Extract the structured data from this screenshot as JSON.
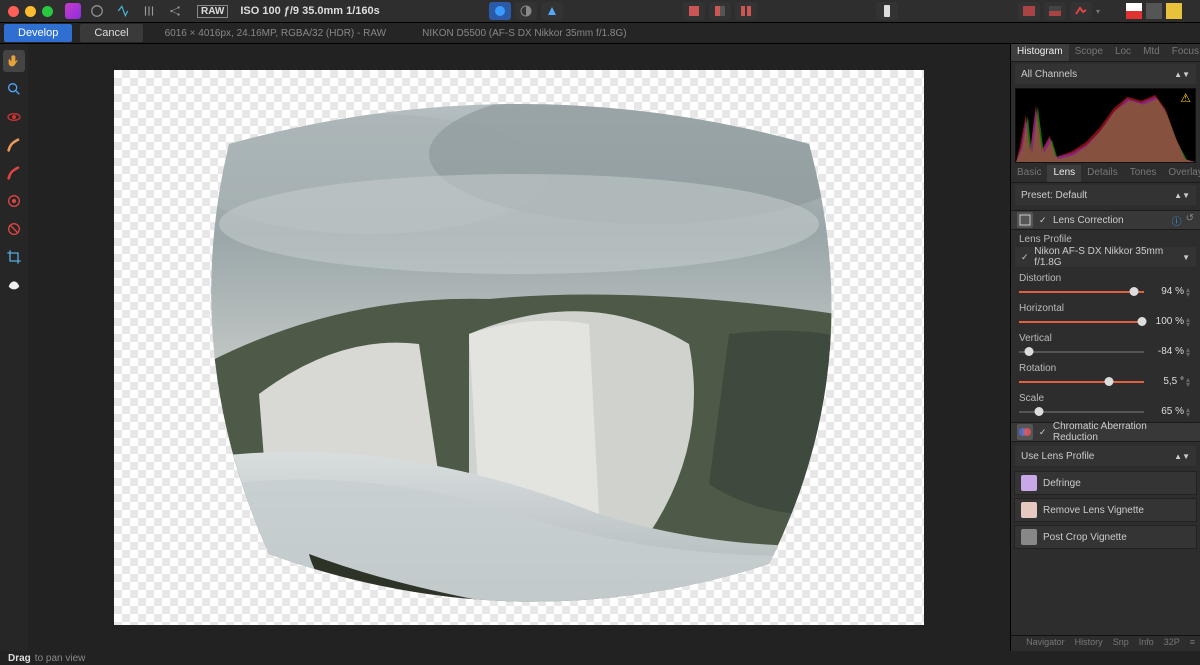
{
  "window": {
    "raw_badge": "RAW",
    "exposure": "ISO 100 ƒ/9 35.0mm 1/160s"
  },
  "devbar": {
    "develop": "Develop",
    "cancel": "Cancel",
    "fileinfo": "6016 × 4016px, 24.16MP, RGBA/32 (HDR) - RAW",
    "camera": "NIKON D5500 (AF-S DX Nikkor 35mm f/1.8G)"
  },
  "histogram": {
    "tabs": [
      "Histogram",
      "Scope",
      "Loc",
      "Mtd",
      "Focus"
    ],
    "active": 0,
    "channel": "All Channels"
  },
  "adjust_tabs": {
    "items": [
      "Basic",
      "Lens",
      "Details",
      "Tones",
      "Overlays"
    ],
    "active": 1
  },
  "preset": {
    "label": "Preset:",
    "value": "Default"
  },
  "lens": {
    "correction_label": "Lens Correction",
    "profile_label": "Lens Profile",
    "profile_value": "Nikon AF-S DX Nikkor 35mm f/1.8G",
    "sliders": [
      {
        "label": "Distortion",
        "value": "94 %",
        "pos": 92,
        "color": "orange"
      },
      {
        "label": "Horizontal",
        "value": "100 %",
        "pos": 98,
        "color": "orange"
      },
      {
        "label": "Vertical",
        "value": "-84 %",
        "pos": 8,
        "color": "grey"
      },
      {
        "label": "Rotation",
        "value": "5,5 °",
        "pos": 72,
        "color": "orange"
      },
      {
        "label": "Scale",
        "value": "65 %",
        "pos": 16,
        "color": "grey"
      }
    ],
    "chromab": "Chromatic Aberration Reduction",
    "uselens": "Use Lens Profile"
  },
  "extra_panels": [
    "Defringe",
    "Remove Lens Vignette",
    "Post Crop Vignette"
  ],
  "bottom_tabs": [
    "Navigator",
    "History",
    "Snp",
    "Info",
    "32P"
  ],
  "status": {
    "action": "Drag",
    "hint": "to pan view"
  }
}
